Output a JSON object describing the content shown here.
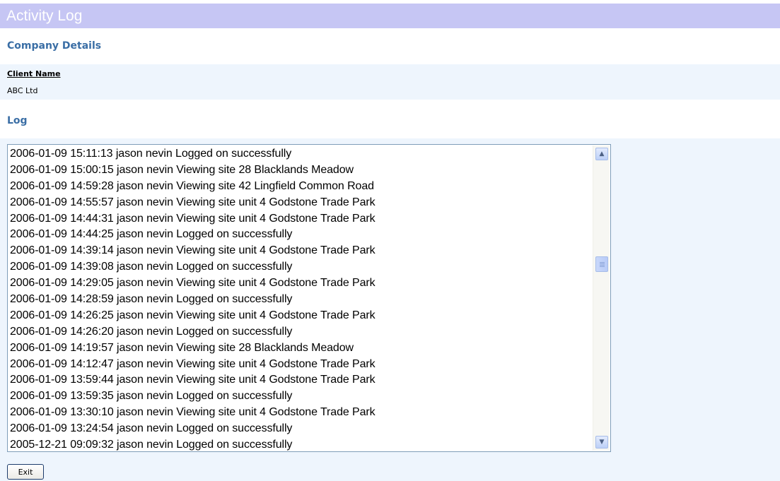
{
  "header": {
    "title": "Activity Log"
  },
  "company": {
    "heading": "Company Details",
    "client_name_label": "Client Name",
    "client_name_value": "ABC Ltd"
  },
  "log": {
    "heading": "Log",
    "entries": [
      "2006-01-09 15:11:13 jason nevin Logged on successfully",
      "2006-01-09 15:00:15 jason nevin Viewing site 28 Blacklands Meadow",
      "2006-01-09 14:59:28 jason nevin Viewing site 42 Lingfield Common Road",
      "2006-01-09 14:55:57 jason nevin Viewing site unit 4 Godstone Trade Park",
      "2006-01-09 14:44:31 jason nevin Viewing site unit 4 Godstone Trade Park",
      "2006-01-09 14:44:25 jason nevin Logged on successfully",
      "2006-01-09 14:39:14 jason nevin Viewing site unit 4 Godstone Trade Park",
      "2006-01-09 14:39:08 jason nevin Logged on successfully",
      "2006-01-09 14:29:05 jason nevin Viewing site unit 4 Godstone Trade Park",
      "2006-01-09 14:28:59 jason nevin Logged on successfully",
      "2006-01-09 14:26:25 jason nevin Viewing site unit 4 Godstone Trade Park",
      "2006-01-09 14:26:20 jason nevin Logged on successfully",
      "2006-01-09 14:19:57 jason nevin Viewing site 28 Blacklands Meadow",
      "2006-01-09 14:12:47 jason nevin Viewing site unit 4 Godstone Trade Park",
      "2006-01-09 13:59:44 jason nevin Viewing site unit 4 Godstone Trade Park",
      "2006-01-09 13:59:35 jason nevin Logged on successfully",
      "2006-01-09 13:30:10 jason nevin Viewing site unit 4 Godstone Trade Park",
      "2006-01-09 13:24:54 jason nevin Logged on successfully",
      "2005-12-21 09:09:32 jason nevin Logged on successfully"
    ]
  },
  "actions": {
    "exit_label": "Exit"
  },
  "icons": {
    "scroll_up": "scroll-up-arrow-icon",
    "scroll_down": "scroll-down-arrow-icon"
  },
  "colors": {
    "title_bar": "#c6c6f4",
    "heading": "#3a6ea5",
    "panel": "#eef5fd"
  }
}
